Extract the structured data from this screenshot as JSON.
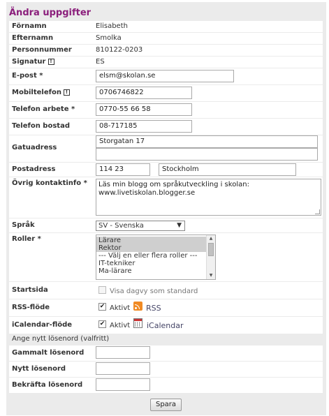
{
  "title": "Ändra uppgifter",
  "fields": {
    "fornamn": {
      "label": "Förnamn",
      "value": "Elisabeth"
    },
    "efternamn": {
      "label": "Efternamn",
      "value": "Smolka"
    },
    "personnummer": {
      "label": "Personnummer",
      "value": "810122-0203"
    },
    "signatur": {
      "label": "Signatur",
      "value": "ES"
    },
    "epost": {
      "label": "E-post",
      "required": "*",
      "value": "elsm@skolan.se"
    },
    "mobil": {
      "label": "Mobiltelefon",
      "value": "0706746822"
    },
    "tel_arbete": {
      "label": "Telefon arbete",
      "required": "*",
      "value": "0770-55 66 58"
    },
    "tel_bostad": {
      "label": "Telefon bostad",
      "value": "08-717185"
    },
    "gatuadress": {
      "label": "Gatuadress",
      "line1": "Storgatan 17",
      "line2": ""
    },
    "postadress": {
      "label": "Postadress",
      "postnummer": "114 23",
      "ort": "Stockholm"
    },
    "ovrig": {
      "label": "Övrig kontaktinfo",
      "required": "*",
      "line1": "Läs min blogg om språkutveckling i skolan:",
      "line2": "www.livetiskolan.blogger.se"
    },
    "sprak": {
      "label": "Språk",
      "value": "SV - Svenska"
    },
    "roller": {
      "label": "Roller",
      "required": "*",
      "options": [
        "Lärare",
        "Rektor",
        "--- Välj en eller flera roller ---",
        "IT-tekniker",
        "Ma-lärare"
      ],
      "selected": [
        "Lärare",
        "Rektor"
      ]
    },
    "startsida": {
      "label": "Startsida",
      "checkbox_label": "Visa dagvy som standard",
      "checked": false
    },
    "rss": {
      "label": "RSS-flöde",
      "checkbox_label": "Aktivt",
      "link": "RSS",
      "checked": true
    },
    "ical": {
      "label": "iCalendar-flöde",
      "checkbox_label": "Aktivt",
      "link": "iCalendar",
      "checked": true
    }
  },
  "password_section": {
    "heading": "Ange nytt lösenord (valfritt)",
    "gammalt": {
      "label": "Gammalt lösenord",
      "value": ""
    },
    "nytt": {
      "label": "Nytt lösenord",
      "value": ""
    },
    "bekrafta": {
      "label": "Bekräfta lösenord",
      "value": ""
    }
  },
  "save_button": "Spara",
  "icons": {
    "info": "info-icon",
    "rss": "rss-icon",
    "calendar": "calendar-icon",
    "dropdown": "chevron-down-icon"
  },
  "colors": {
    "title": "#8b1f7c",
    "panel": "#ebebeb",
    "rss": "#f08a24"
  }
}
